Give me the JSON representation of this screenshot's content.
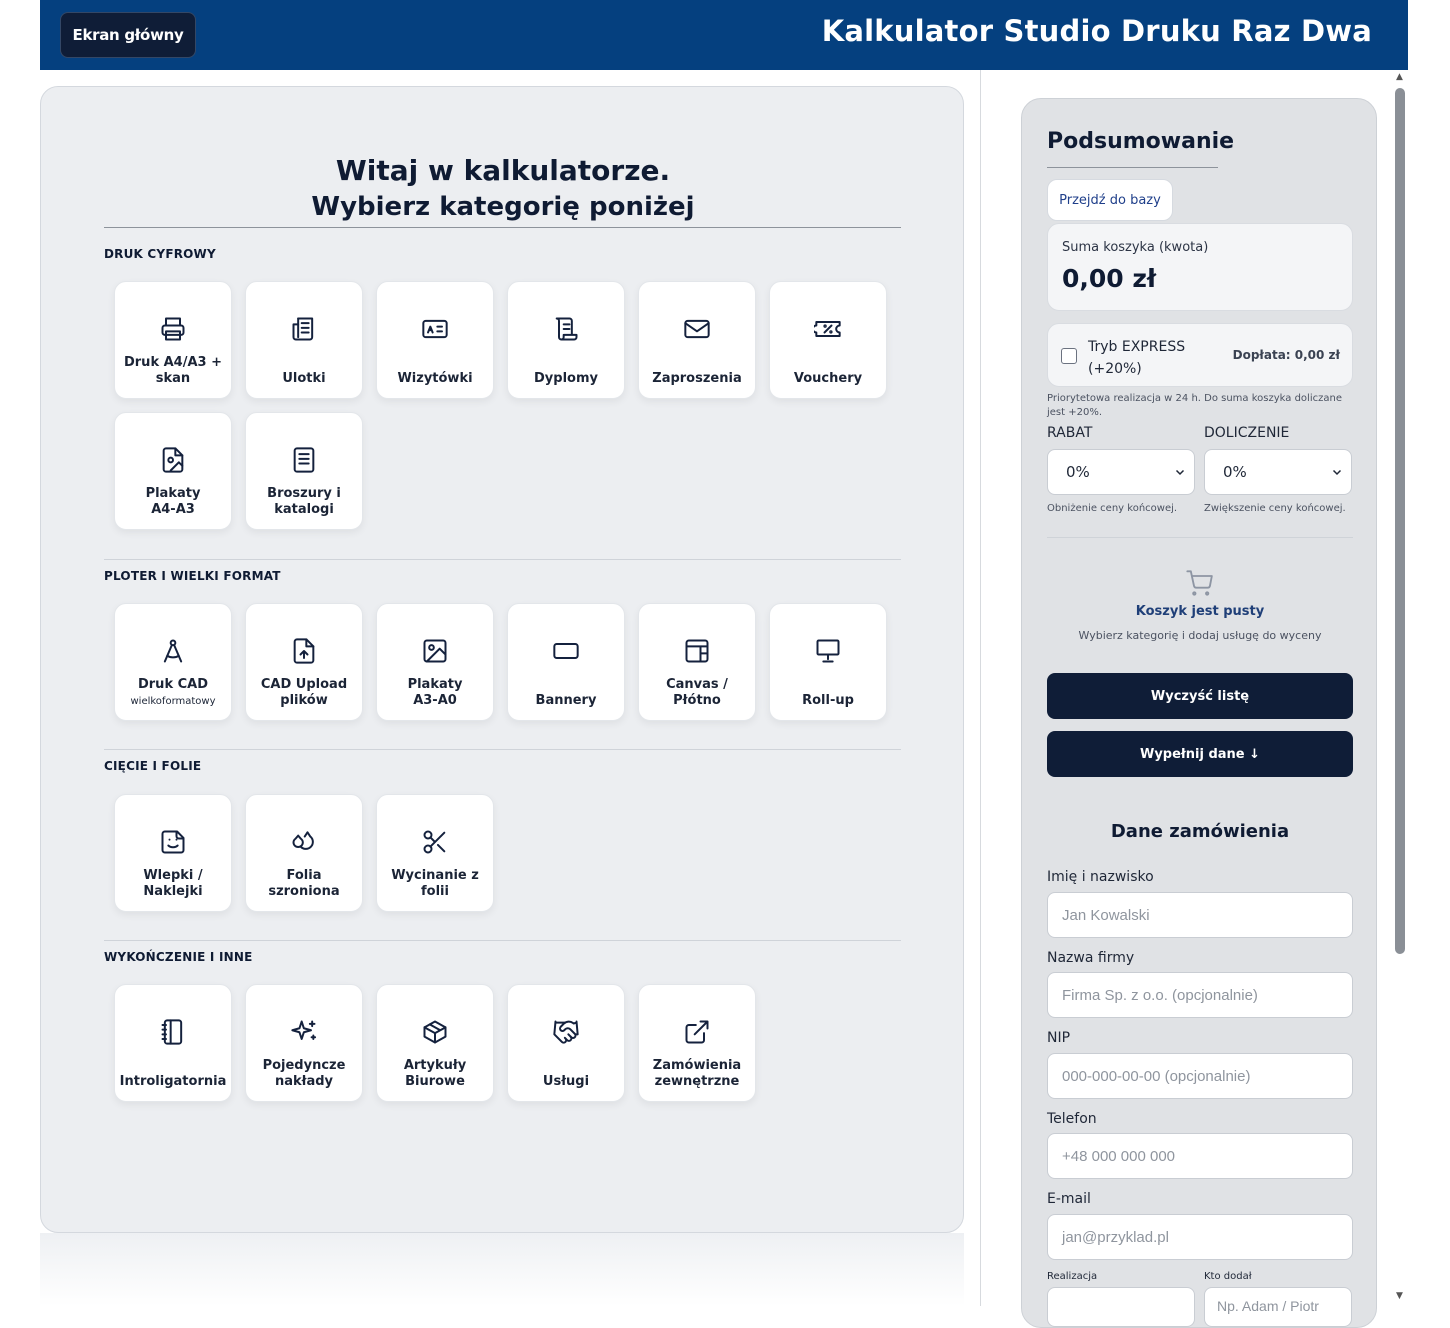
{
  "header": {
    "home_button": "Ekran główny",
    "title": "Kalkulator Studio Druku Raz Dwa",
    "bg_color": "#05407f"
  },
  "welcome": {
    "line1": "Witaj w kalkulatorze.",
    "line2": "Wybierz kategorię poniżej"
  },
  "sections": [
    {
      "title": "DRUK CYFROWY",
      "items": [
        {
          "label": "Druk A4/A3 + skan",
          "icon": "printer-icon"
        },
        {
          "label": "Ulotki",
          "icon": "newspaper-icon"
        },
        {
          "label": "Wizytówki",
          "icon": "id-card-icon"
        },
        {
          "label": "Dyplomy",
          "icon": "scroll-icon"
        },
        {
          "label": "Zaproszenia",
          "icon": "envelope-icon"
        },
        {
          "label": "Vouchery",
          "icon": "ticket-percent-icon"
        },
        {
          "label": "Plakaty A4-A3",
          "icon": "file-image-icon"
        },
        {
          "label": "Broszury i katalogi",
          "icon": "booklet-icon"
        }
      ]
    },
    {
      "title": "PLOTER I WIELKI FORMAT",
      "items": [
        {
          "label": "Druk CAD",
          "sub": "wielkoformatowy",
          "icon": "compass-icon"
        },
        {
          "label": "CAD Upload plików",
          "icon": "file-upload-icon"
        },
        {
          "label": "Plakaty A3-A0",
          "icon": "image-icon"
        },
        {
          "label": "Bannery",
          "icon": "banner-rectangle-icon"
        },
        {
          "label": "Canvas / Płótno",
          "icon": "canvas-frame-icon"
        },
        {
          "label": "Roll-up",
          "icon": "presentation-stand-icon"
        }
      ]
    },
    {
      "title": "CIĘCIE I FOLIE",
      "items": [
        {
          "label": "Wlepki / Naklejki",
          "icon": "sticker-icon"
        },
        {
          "label": "Folia szroniona",
          "icon": "droplets-icon"
        },
        {
          "label": "Wycinanie z folii",
          "icon": "scissors-icon"
        }
      ]
    },
    {
      "title": "WYKOŃCZENIE I INNE",
      "items": [
        {
          "label": "Introligatornia",
          "icon": "notebook-icon"
        },
        {
          "label": "Pojedyncze nakłady",
          "icon": "sparkles-icon"
        },
        {
          "label": "Artykuły Biurowe",
          "icon": "box-icon"
        },
        {
          "label": "Usługi",
          "icon": "handshake-icon"
        },
        {
          "label": "Zamówienia zewnętrzne",
          "icon": "external-link-icon"
        }
      ]
    }
  ],
  "summary": {
    "title": "Podsumowanie",
    "base_button": "Przejdź do bazy",
    "cart_sum_label": "Suma koszyka (kwota)",
    "cart_sum_value": "0,00 zł",
    "express_label": "Tryb EXPRESS (+20%)",
    "express_surcharge": "Dopłata: 0,00 zł",
    "express_checked": false,
    "express_note": "Priorytetowa realizacja w 24 h. Do suma koszyka doliczane jest +20%.",
    "discount_label": "RABAT",
    "discount_value": "0%",
    "discount_note": "Obniżenie ceny końcowej.",
    "surcharge_label": "DOLICZENIE",
    "surcharge_value": "0%",
    "surcharge_note": "Zwiększenie ceny końcowej.",
    "empty_title": "Koszyk jest pusty",
    "empty_sub": "Wybierz kategorię i dodaj usługę do wyceny",
    "clear_button": "Wyczyść listę",
    "fill_button": "Wypełnij dane ↓"
  },
  "order": {
    "title": "Dane zamówienia",
    "fields": [
      {
        "label": "Imię i nazwisko",
        "placeholder": "Jan Kowalski"
      },
      {
        "label": "Nazwa firmy",
        "placeholder": "Firma Sp. z o.o. (opcjonalnie)"
      },
      {
        "label": "NIP",
        "placeholder": "000-000-00-00 (opcjonalnie)"
      },
      {
        "label": "Telefon",
        "placeholder": "+48 000 000 000"
      },
      {
        "label": "E-mail",
        "placeholder": "jan@przyklad.pl"
      }
    ],
    "realizacja_label": "Realizacja",
    "kto_dodal_label": "Kto dodał",
    "kto_dodal_placeholder": "Np. Adam / Piotr"
  }
}
